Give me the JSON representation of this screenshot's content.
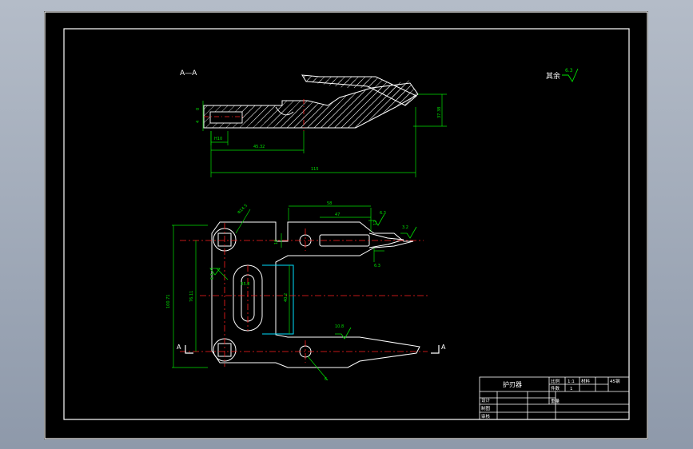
{
  "section_label": "A—A",
  "remaining_roughness": {
    "text": "其余",
    "value": "6.3"
  },
  "section_view": {
    "dims": {
      "d_small_left": "0",
      "d_h1": "4",
      "d_h2": "H10",
      "d_mid": "45.32",
      "d_total": "115",
      "d_right": "37.38"
    }
  },
  "plan_view": {
    "section_marks": {
      "left": "A",
      "right": "A"
    },
    "dims": {
      "hole_dia": "Φ14.5",
      "top_len": "58",
      "top_len2": "47",
      "slot_w": "10",
      "width_a": "12",
      "rough_a": "6.3",
      "rough_b": "3.2",
      "rough_c": "6.3",
      "total_h": "100.71",
      "pitch": "76.11",
      "rough_left": "6.3",
      "slot_dim": "R5.8",
      "inner_h": "40.2",
      "small_right": "10.8",
      "hole_leader": "6"
    }
  },
  "title_block": {
    "part_name": "护刃器",
    "scale_label": "比例",
    "scale_value": "1:1",
    "material_label": "材料",
    "material_value": "45钢",
    "count_label": "件数",
    "count_value": "1",
    "weight_label": "重量",
    "design_label": "设计",
    "draw_label": "制图",
    "review_label": "审核"
  }
}
